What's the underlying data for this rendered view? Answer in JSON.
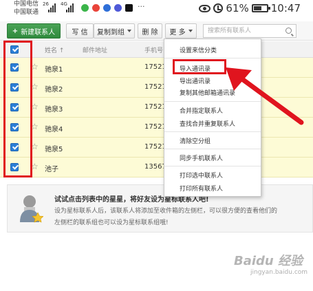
{
  "status_bar": {
    "carrier1": "中国电信",
    "carrier2": "中国联通",
    "net1": "26",
    "net2": "4G",
    "battery": "61%",
    "time": "10:47"
  },
  "toolbar": {
    "new_contact": "新建联系人",
    "write": "写 信",
    "copy_to_group": "复制到组",
    "delete": "删 除",
    "more": "更 多",
    "search_placeholder": "搜索所有联系人"
  },
  "table": {
    "headers": {
      "name": "姓名 ↑",
      "email": "邮件地址",
      "phone": "手机号"
    },
    "rows": [
      {
        "name": "驰泉1",
        "phone": "17521"
      },
      {
        "name": "驰泉2",
        "phone": "17521"
      },
      {
        "name": "驰泉3",
        "phone": "17521"
      },
      {
        "name": "驰泉4",
        "phone": "17521"
      },
      {
        "name": "驰泉5",
        "phone": "17521"
      },
      {
        "name": "池子",
        "phone": "13567"
      }
    ]
  },
  "menu": {
    "items": [
      "设置来信分类",
      "导入通讯录",
      "导出通讯录",
      "复制其他邮箱通讯录",
      "合并指定联系人",
      "查找合并重复联系人",
      "清除空分组",
      "同步手机联系人",
      "打印选中联系人",
      "打印所有联系人"
    ]
  },
  "tip": {
    "title": "试试点击列表中的星星，将好友设为星标联系人吧!",
    "line1": "设为星标联系人后，该联系人将添加至收件箱的左侧栏，可以很方便的查看他们的",
    "line2": "左侧栏的联系组也可以设为星标联系组哦!"
  },
  "watermark": {
    "brand": "Baidu 经验",
    "url": "jingyan.baidu.com"
  },
  "colors": {
    "highlight_red": "#e0141e",
    "row_yellow": "#fdfbd6",
    "primary_green": "#3a9648",
    "checkbox_blue": "#2b7fd6"
  }
}
